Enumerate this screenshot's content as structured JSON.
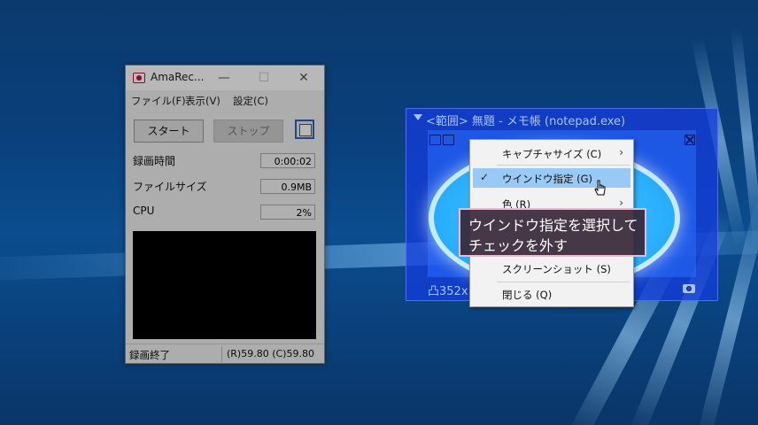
{
  "amarec": {
    "title": "AmaRec...",
    "controls": {
      "minimize": "—",
      "maximize": "☐",
      "close": "✕"
    },
    "menu": [
      "ファイル(F)",
      "表示(V)",
      "設定(C)"
    ],
    "start_label": "スタート",
    "stop_label": "ストップ",
    "stats": [
      {
        "label": "録画時間",
        "value": "0:00:02"
      },
      {
        "label": "ファイルサイズ",
        "value": "0.9MB"
      },
      {
        "label": "CPU",
        "value": "2%"
      }
    ],
    "status_left": "録画終了",
    "status_right": "(R)59.80 (C)59.80"
  },
  "capture": {
    "title": "<範囲> 無題 - メモ帳 (notepad.exe)",
    "size_text": "凸352x"
  },
  "context_menu": {
    "items": [
      {
        "label": "キャプチャサイズ (C)",
        "submenu": "›"
      },
      {
        "label": "ウインドウ指定 (G)",
        "checked": "✓"
      },
      {
        "label": "色 (R)",
        "submenu": "›"
      },
      {
        "label": "スクリーンショット (S)"
      },
      {
        "label": "閉じる (Q)"
      }
    ]
  },
  "callout": {
    "line1": "ウインドウ指定を選択して",
    "line2": "チェックを外す"
  },
  "colors": {
    "highlight": "#99c9f5",
    "capture_frame": "#1e3cdc",
    "callout_border": "#f3b5d6"
  }
}
